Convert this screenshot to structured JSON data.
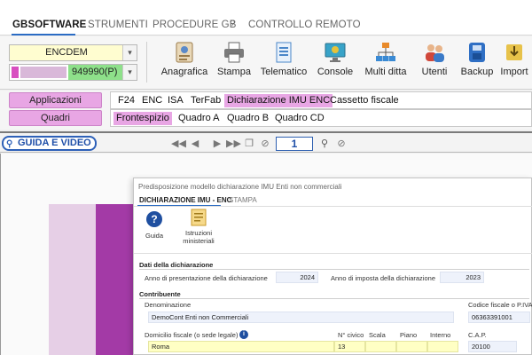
{
  "menu": {
    "items": [
      {
        "label": "GBSOFTWARE",
        "active": true
      },
      {
        "label": "STRUMENTI",
        "active": false
      },
      {
        "label": "PROCEDURE GB",
        "active": false
      },
      {
        "label": "?",
        "active": false
      },
      {
        "label": "CONTROLLO REMOTO",
        "active": false
      }
    ]
  },
  "ribbon": {
    "company_select": "ENCDEM",
    "code_select": "949990(P)",
    "tools": [
      "Anagrafica",
      "Stampa",
      "Telematico",
      "Console",
      "Multi ditta",
      "Utenti",
      "Backup",
      "Import"
    ]
  },
  "nav": {
    "applicazioni": "Applicazioni",
    "quadri": "Quadri",
    "row1_tabs": [
      "F24",
      "ENC",
      "ISA",
      "TerFab",
      "Dichiarazione IMU ENC",
      "Cassetto fiscale"
    ],
    "row1_selected": "Dichiarazione IMU ENC",
    "row2_tabs": [
      "Frontespizio",
      "Quadro A",
      "Quadro B",
      "Quadro CD"
    ],
    "row2_selected": "Frontespizio"
  },
  "viewer": {
    "guida_label": "GUIDA E VIDEO",
    "page_number": "1"
  },
  "dialog": {
    "title": "Predisposizione modello dichiarazione IMU Enti non commerciali",
    "tabs": [
      {
        "label": "DICHIARAZIONE IMU - ENC",
        "active": true
      },
      {
        "label": "STAMPA",
        "active": false
      }
    ],
    "tools": {
      "guida": "Guida",
      "istruzioni_line1": "Istruzioni",
      "istruzioni_line2": "ministeriali"
    },
    "dati": {
      "section": "Dati della dichiarazione",
      "anno_presentazione_label": "Anno di presentazione della dichiarazione",
      "anno_presentazione_value": "2024",
      "anno_imposta_label": "Anno di imposta della dichiarazione",
      "anno_imposta_value": "2023"
    },
    "contribuente": {
      "section": "Contribuente",
      "denominazione_label": "Denominazione",
      "denominazione_value": "DemoCont Enti non Commerciali",
      "codice_fiscale_label": "Codice fiscale o P.IVA",
      "codice_fiscale_value": "06363391001",
      "domicilio_label": "Domicilio fiscale (o sede legale)",
      "domicilio_value": "Roma",
      "civico_label": "N° civico",
      "civico_value": "13",
      "scala_label": "Scala",
      "piano_label": "Piano",
      "interno_label": "Interno",
      "cap_label": "C.A.P.",
      "cap_value": "20100"
    }
  },
  "colors": {
    "pink": "#e8a6e4",
    "accent_blue": "#2b6cc4",
    "purple": "#a33aa6",
    "field_blue": "#eef2fb",
    "field_yellow": "#ffffc4"
  }
}
